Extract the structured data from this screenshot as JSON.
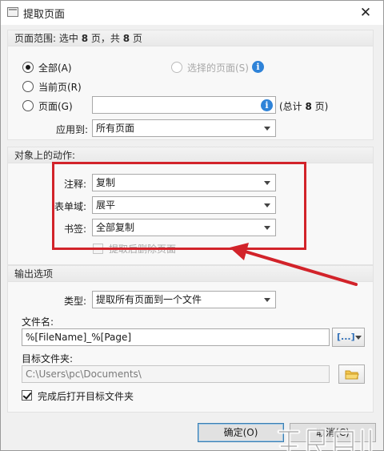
{
  "window": {
    "title": "提取页面",
    "close_glyph": "✕"
  },
  "page_range": {
    "header_prefix": "页面范围: 选中 ",
    "selected_count": "8",
    "header_middle": " 页，共 ",
    "total_count": "8",
    "header_suffix": " 页",
    "all_label": "全部(A)",
    "selected_pages_label": "选择的页面(S)",
    "current_page_label": "当前页(R)",
    "pages_label": "页面(G)",
    "pages_value": "",
    "total_prefix": "(总计 ",
    "total_suffix": " 页)",
    "apply_to_label": "应用到:",
    "apply_to_value": "所有页面"
  },
  "object_actions": {
    "header": "对象上的动作:",
    "annotations_label": "注释:",
    "annotations_value": "复制",
    "form_fields_label": "表单域:",
    "form_fields_value": "展平",
    "bookmarks_label": "书签:",
    "bookmarks_value": "全部复制",
    "delete_after_label": "提取后删除页面"
  },
  "output": {
    "header": "输出选项",
    "type_label": "类型:",
    "type_value": "提取所有页面到一个文件",
    "filename_label": "文件名:",
    "filename_value": "%[FileName]_%[Page]",
    "folder_label": "目标文件夹:",
    "folder_value": "C:\\Users\\pc\\Documents\\",
    "open_after_label": "完成后打开目标文件夹"
  },
  "buttons": {
    "ok": "确定(O)",
    "cancel": "取消(C)"
  },
  "info_glyph": "i",
  "macro_glyph": "[...]",
  "colors": {
    "annotation_red": "#d2232a",
    "info_blue": "#2f83d8",
    "default_button_border": "#3c7fb1"
  }
}
